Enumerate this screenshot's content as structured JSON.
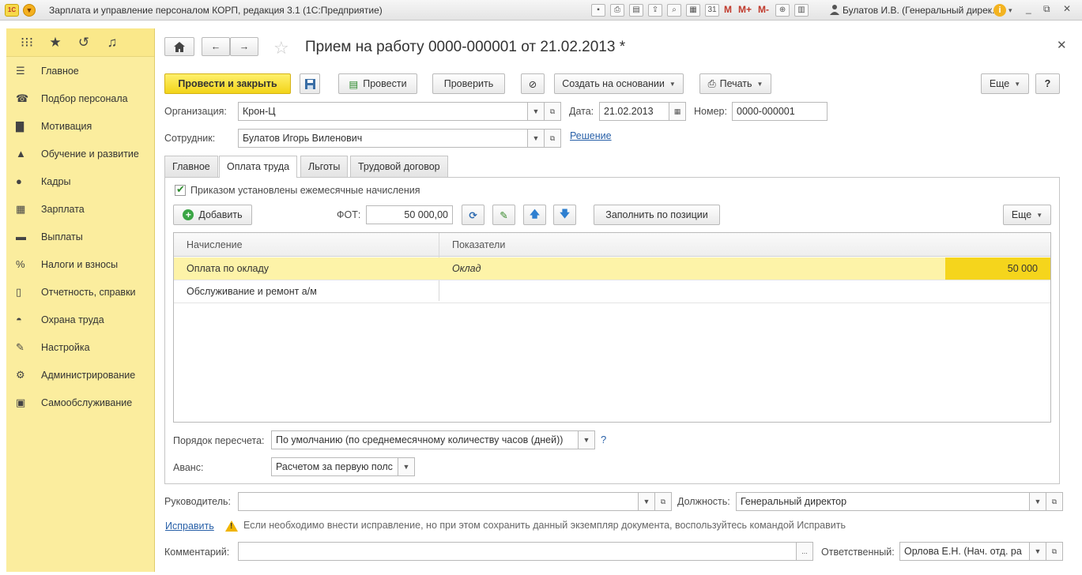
{
  "window": {
    "title": "Зарплата и управление персоналом КОРП, редакция 3.1  (1С:Предприятие)",
    "logo_text": "1С",
    "user": "Булатов И.В. (Генеральный дирек...",
    "memory_buttons": [
      "M",
      "M+",
      "M-"
    ],
    "controls": [
      "_",
      "⧉",
      "✕"
    ]
  },
  "sidebar": {
    "top_icons": [
      "apps-icon",
      "star-icon",
      "history-icon",
      "bell-icon"
    ],
    "items": [
      {
        "label": "Главное",
        "icon": "menu-icon"
      },
      {
        "label": "Подбор персонала",
        "icon": "recruit-icon"
      },
      {
        "label": "Мотивация",
        "icon": "motivation-icon"
      },
      {
        "label": "Обучение и развитие",
        "icon": "graduation-cap-icon"
      },
      {
        "label": "Кадры",
        "icon": "people-icon"
      },
      {
        "label": "Зарплата",
        "icon": "calculator-icon"
      },
      {
        "label": "Выплаты",
        "icon": "payments-icon"
      },
      {
        "label": "Налоги и взносы",
        "icon": "percent-icon"
      },
      {
        "label": "Отчетность, справки",
        "icon": "reports-icon"
      },
      {
        "label": "Охрана труда",
        "icon": "helmet-icon"
      },
      {
        "label": "Настройка",
        "icon": "wrench-icon"
      },
      {
        "label": "Администрирование",
        "icon": "gear-icon"
      },
      {
        "label": "Самообслуживание",
        "icon": "self-service-icon"
      }
    ]
  },
  "document": {
    "title": "Прием на работу 0000-000001 от 21.02.2013 *"
  },
  "toolbar": {
    "post_close": "Провести и закрыть",
    "post": "Провести",
    "check": "Проверить",
    "create_based": "Создать на основании",
    "print": "Печать",
    "more": "Еще",
    "help": "?"
  },
  "header_fields": {
    "org_label": "Организация:",
    "org_value": "Крон-Ц",
    "date_label": "Дата:",
    "date_value": "21.02.2013",
    "number_label": "Номер:",
    "number_value": "0000-000001",
    "employee_label": "Сотрудник:",
    "employee_value": "Булатов Игорь Виленович",
    "decision_link": "Решение"
  },
  "tabs": [
    {
      "label": "Главное",
      "active": false
    },
    {
      "label": "Оплата труда",
      "active": true
    },
    {
      "label": "Льготы",
      "active": false
    },
    {
      "label": "Трудовой договор",
      "active": false
    }
  ],
  "pay_tab": {
    "monthly_checkbox": "Приказом установлены ежемесячные начисления",
    "add_button": "Добавить",
    "fot_label": "ФОТ:",
    "fot_value": "50 000,00",
    "fill_button": "Заполнить по позиции",
    "more_button": "Еще",
    "columns": [
      "Начисление",
      "Показатели"
    ],
    "rows": [
      {
        "accrual": "Оплата по окладу",
        "indicator": "Оклад",
        "value": "50 000"
      },
      {
        "accrual": "Обслуживание и ремонт а/м",
        "indicator": "",
        "value": ""
      }
    ],
    "recalc_label": "Порядок пересчета:",
    "recalc_value": "По умолчанию (по среднемесячному количеству часов (дней))",
    "recalc_help": "?",
    "advance_label": "Аванс:",
    "advance_value": "Расчетом за первую полс"
  },
  "footer": {
    "manager_label": "Руководитель:",
    "manager_value": "",
    "position_label": "Должность:",
    "position_value": "Генеральный директор",
    "fix_link": "Исправить",
    "fix_hint": "Если необходимо внести исправление, но при этом сохранить данный экземпляр документа, воспользуйтесь командой Исправить",
    "comment_label": "Комментарий:",
    "comment_value": "",
    "comment_button": "...",
    "responsible_label": "Ответственный:",
    "responsible_value": "Орлова Е.Н. (Нач. отд. ра"
  },
  "colors": {
    "sidebar_bg": "#fbed9e",
    "primary_button": "#f2d419",
    "selected_row": "#fdf3a8",
    "selected_cell": "#f5d51c",
    "link": "#2860a8"
  }
}
